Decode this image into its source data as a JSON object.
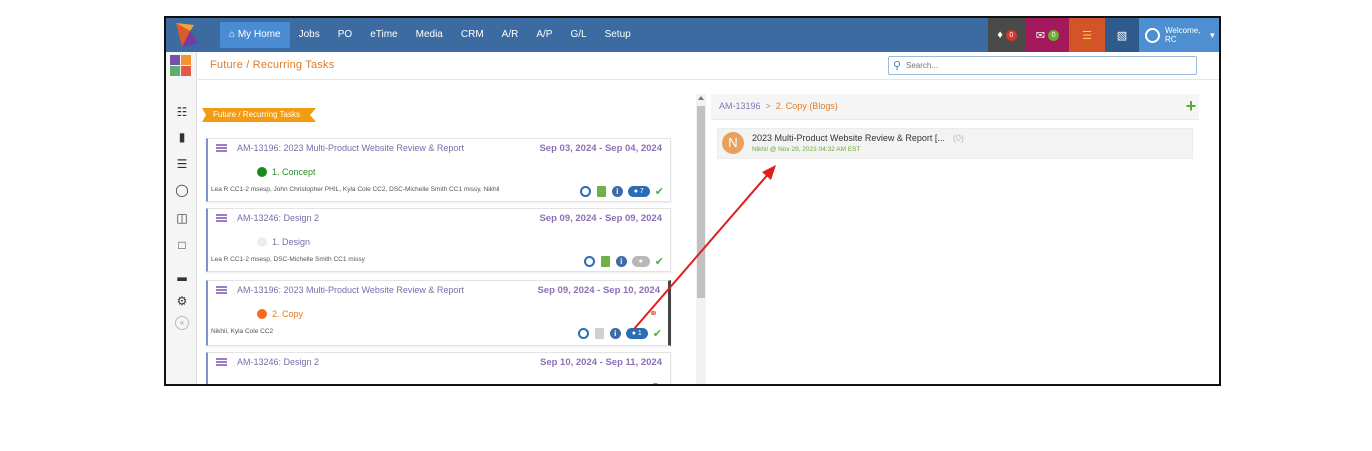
{
  "navbar": {
    "items": [
      {
        "label": "My Home",
        "active": true
      },
      {
        "label": "Jobs"
      },
      {
        "label": "PO"
      },
      {
        "label": "eTime"
      },
      {
        "label": "Media"
      },
      {
        "label": "CRM"
      },
      {
        "label": "A/R"
      },
      {
        "label": "A/P"
      },
      {
        "label": "G/L"
      },
      {
        "label": "Setup"
      }
    ],
    "notifications_count": "0",
    "messages_count": "0",
    "welcome_label": "Welcome,",
    "user_initials": "RC"
  },
  "page": {
    "title": "Future / Recurring Tasks",
    "search_placeholder": "Search..."
  },
  "tasks_pane": {
    "ribbon_label": "Future / Recurring Tasks",
    "tasks": [
      {
        "title": "AM-13196: 2023 Multi-Product Website Review & Report",
        "dates": "Sep 03, 2024 - Sep 04, 2024",
        "status": "1. Concept",
        "status_color": "#1a8a1a",
        "assignees": "Lea R CC1-2 msesp, John Christopher PHIL, Kyla Cole CC2, DSC-Michelle Smith CC1 missy, Nikhil",
        "comments": "7"
      },
      {
        "title": "AM-13246: Design 2",
        "dates": "Sep 09, 2024 - Sep 09, 2024",
        "status": "1. Design",
        "status_color": "#eeeeee",
        "assignees": "Lea R CC1-2 msesp, DSC-Michelle Smith CC1 missy",
        "comments": ""
      },
      {
        "title": "AM-13196: 2023 Multi-Product Website Review & Report",
        "dates": "Sep 09, 2024 - Sep 10, 2024",
        "status": "2. Copy",
        "status_color": "#f26d21",
        "assignees": "Nikhil, Kyla Cole CC2",
        "comments": "1"
      },
      {
        "title": "AM-13246: Design 2",
        "dates": "Sep 10, 2024 - Sep 11, 2024",
        "status": "",
        "status_color": "#eeeeee",
        "assignees": "",
        "comments": ""
      }
    ]
  },
  "blog_pane": {
    "crumb_job": "AM-13196",
    "crumb_separator": ">",
    "crumb_task": "2. Copy (Blogs)",
    "blog": {
      "avatar_letter": "N",
      "title": "2023 Multi-Product Website Review & Report [...",
      "count": "(0)",
      "meta": "Nikhil @ Nov 29, 2023 04:32 AM EST"
    }
  },
  "colors": {
    "navbar": "#3b6ba1",
    "accent_orange": "#e07b28",
    "ribbon": "#f39c12",
    "annotation_arrow": "#e01e1e"
  }
}
